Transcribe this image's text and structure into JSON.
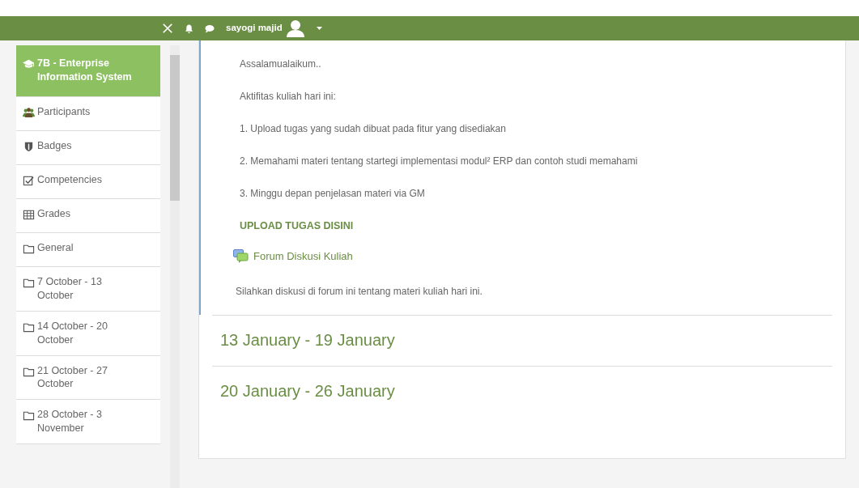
{
  "navbar": {
    "user_name": "sayogi majid"
  },
  "sidebar": {
    "items": [
      {
        "kind": "course",
        "label": "7B - Enterprise Information System",
        "selected": true
      },
      {
        "kind": "participants",
        "label": "Participants",
        "selected": false
      },
      {
        "kind": "badges",
        "label": "Badges",
        "selected": false
      },
      {
        "kind": "competencies",
        "label": "Competencies",
        "selected": false
      },
      {
        "kind": "grades",
        "label": "Grades",
        "selected": false
      },
      {
        "kind": "section",
        "label": "General",
        "selected": false
      },
      {
        "kind": "section",
        "label": "7 October - 13 October",
        "selected": false
      },
      {
        "kind": "section",
        "label": "14 October - 20 October",
        "selected": false
      },
      {
        "kind": "section",
        "label": "21 October - 27 October",
        "selected": false
      },
      {
        "kind": "section",
        "label": "28 October - 3 November",
        "selected": false
      }
    ]
  },
  "section": {
    "paragraphs": [
      "Assalamualaikum..",
      "Aktifitas kuliah hari ini:",
      "1. Upload tugas yang sudah dibuat pada fitur yang disediakan",
      "2. Memahami materi tentang startegi implementasi modul² ERP dan contoh studi memahami",
      "3. Minggu depan penjelasan materi via GM"
    ],
    "upload_link": "UPLOAD TUGAS DISINI",
    "forum": {
      "title": "Forum Diskusi Kuliah",
      "description": "Silahkan diskusi di forum ini tentang materi kuliah hari ini."
    }
  },
  "weeks": [
    "13 January - 19 January",
    "20 January - 26 January"
  ]
}
